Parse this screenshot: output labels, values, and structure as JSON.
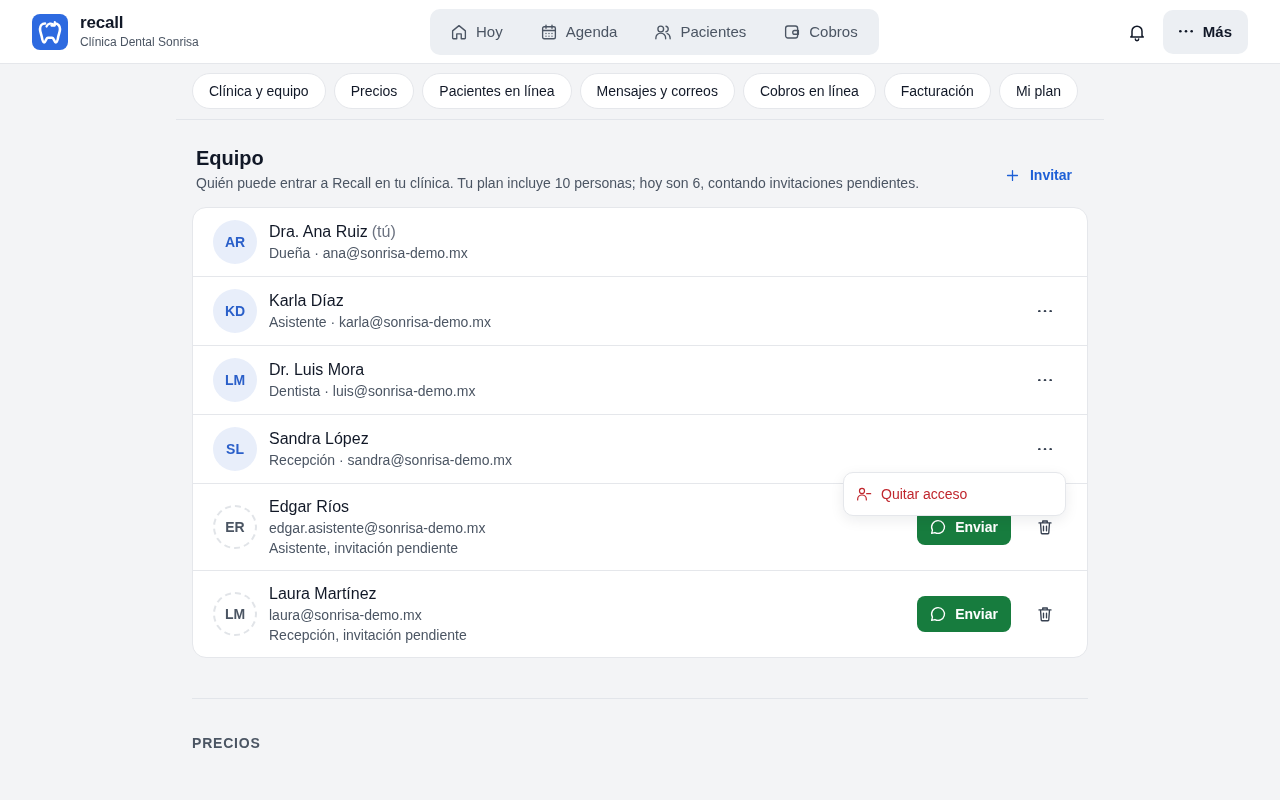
{
  "header": {
    "app_name": "recall",
    "clinic": "Clínica Dental Sonrisa",
    "nav": [
      {
        "label": "Hoy",
        "selected": false
      },
      {
        "label": "Agenda",
        "selected": false
      },
      {
        "label": "Pacientes",
        "selected": false
      },
      {
        "label": "Cobros",
        "selected": false
      }
    ],
    "more_button": {
      "label": "Más",
      "selected": true
    }
  },
  "settings_tabs": [
    "Clínica y equipo",
    "Precios",
    "Pacientes en línea",
    "Mensajes y correos",
    "Cobros en línea",
    "Facturación",
    "Mi plan"
  ],
  "team": {
    "title": "Equipo",
    "description": "Quién puede entrar a Recall en tu clínica. Tu plan incluye 10 personas; hoy son 6, contando invitaciones pendientes.",
    "invite_button": "Invitar",
    "members": [
      {
        "kind": "owner",
        "initials": "AR",
        "name": "Dra. Ana Ruiz",
        "note": "(tú)",
        "detail": "Dueña · ana@sonrisa-demo.mx"
      },
      {
        "kind": "member",
        "initials": "KD",
        "name": "Karla Díaz",
        "detail": "Asistente · karla@sonrisa-demo.mx"
      },
      {
        "kind": "member",
        "initials": "LM",
        "name": "Dr. Luis Mora",
        "detail": "Dentista · luis@sonrisa-demo.mx"
      },
      {
        "kind": "member",
        "initials": "SL",
        "name": "Sandra López",
        "detail": "Recepción · sandra@sonrisa-demo.mx",
        "menu": [
          {
            "label": "Quitar acceso"
          }
        ]
      },
      {
        "kind": "invite",
        "initials": "ER",
        "name": "Edgar Ríos",
        "email": "edgar.asistente@sonrisa-demo.mx",
        "status": "Asistente, invitación pendiente",
        "send_button": "Enviar"
      },
      {
        "kind": "invite",
        "initials": "LM",
        "name": "Laura Martínez",
        "email": "laura@sonrisa-demo.mx",
        "status": "Recepción, invitación pendiente",
        "send_button": "Enviar"
      }
    ]
  },
  "next_section": {
    "title": "PRECIOS"
  }
}
